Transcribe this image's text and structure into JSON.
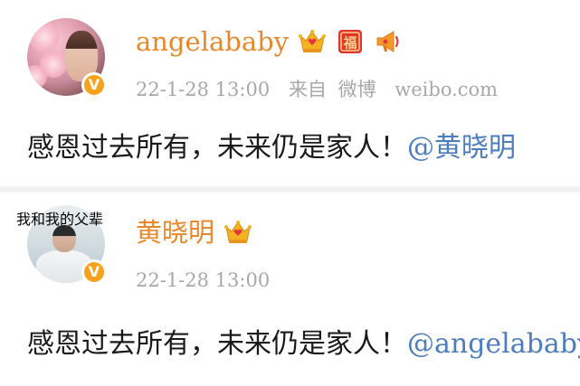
{
  "posts": [
    {
      "username": "angelababy",
      "timestamp": "22-1-28 13:00",
      "source_prefix": "来自",
      "source_app": "微博",
      "source_domain": "weibo.com",
      "verified_mark": "V",
      "badges": [
        "crown-badge-icon",
        "fu-badge-icon",
        "megaphone-badge-icon"
      ],
      "content_text": "感恩过去所有，未来仍是家人！",
      "mention": "@黄晓明"
    },
    {
      "username": "黄晓明",
      "timestamp": "22-1-28 13:00",
      "verified_mark": "V",
      "avatar_banner": "我和我的父辈",
      "badges": [
        "crown-badge-icon"
      ],
      "content_text": "感恩过去所有，未来仍是家人！",
      "mention": "@angelababy"
    }
  ],
  "colors": {
    "username": "#e8882a",
    "mention": "#4b7dbf",
    "meta": "#a8a8a8",
    "verified": "#f7a21b",
    "divider": "#f2f2f2"
  }
}
